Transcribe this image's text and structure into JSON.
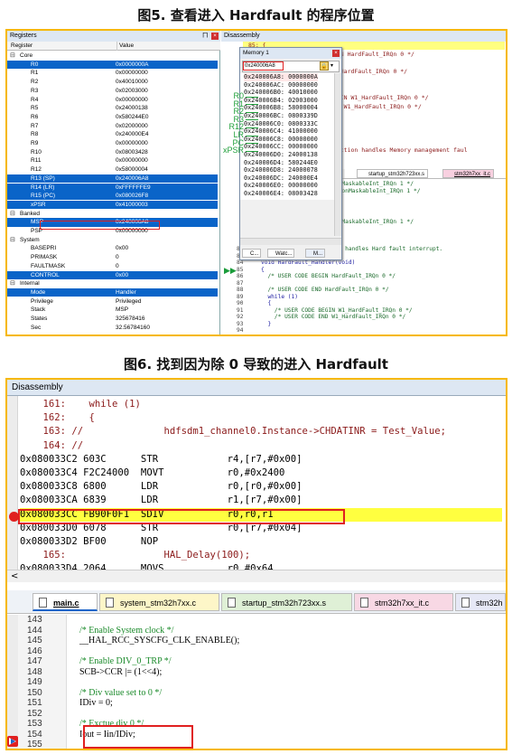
{
  "fig5": {
    "caption": "图5. 查看进入 Hardfault 的程序位置",
    "registers": {
      "title": "Registers",
      "pin_icon": "pin-icon",
      "col_register": "Register",
      "col_value": "Value",
      "rows": [
        {
          "name": "Core",
          "value": "",
          "kind": "group",
          "sel": false
        },
        {
          "name": "R0",
          "value": "0x0000000A",
          "kind": "reg",
          "sel": true
        },
        {
          "name": "R1",
          "value": "0x00000000",
          "kind": "reg",
          "sel": false
        },
        {
          "name": "R2",
          "value": "0x40010000",
          "kind": "reg",
          "sel": false
        },
        {
          "name": "R3",
          "value": "0x02003000",
          "kind": "reg",
          "sel": false
        },
        {
          "name": "R4",
          "value": "0x00000000",
          "kind": "reg",
          "sel": false
        },
        {
          "name": "R5",
          "value": "0x24000138",
          "kind": "reg",
          "sel": false
        },
        {
          "name": "R6",
          "value": "0x580244E0",
          "kind": "reg",
          "sel": false
        },
        {
          "name": "R7",
          "value": "0x02000000",
          "kind": "reg",
          "sel": false
        },
        {
          "name": "R8",
          "value": "0x240000E4",
          "kind": "reg",
          "sel": false
        },
        {
          "name": "R9",
          "value": "0x00000000",
          "kind": "reg",
          "sel": false
        },
        {
          "name": "R10",
          "value": "0x08003428",
          "kind": "reg",
          "sel": false
        },
        {
          "name": "R11",
          "value": "0x00000000",
          "kind": "reg",
          "sel": false
        },
        {
          "name": "R12",
          "value": "0x58000004",
          "kind": "reg",
          "sel": false
        },
        {
          "name": "R13 (SP)",
          "value": "0x240006A8",
          "kind": "reg",
          "sel": true
        },
        {
          "name": "R14 (LR)",
          "value": "0xFFFFFFE9",
          "kind": "reg",
          "sel": true
        },
        {
          "name": "R15 (PC)",
          "value": "0x080026F8",
          "kind": "reg",
          "sel": true
        },
        {
          "name": "xPSR",
          "value": "0x41000003",
          "kind": "reg",
          "sel": true
        },
        {
          "name": "Banked",
          "value": "",
          "kind": "group",
          "sel": false
        },
        {
          "name": "MSP",
          "value": "0x240006A8",
          "kind": "reg",
          "sel": true
        },
        {
          "name": "PSP",
          "value": "0x00000000",
          "kind": "reg",
          "sel": false
        },
        {
          "name": "System",
          "value": "",
          "kind": "group",
          "sel": false
        },
        {
          "name": "BASEPRI",
          "value": "0x00",
          "kind": "reg",
          "sel": false
        },
        {
          "name": "PRIMASK",
          "value": "0",
          "kind": "reg",
          "sel": false
        },
        {
          "name": "FAULTMASK",
          "value": "0",
          "kind": "reg",
          "sel": false
        },
        {
          "name": "CONTROL",
          "value": "0x00",
          "kind": "reg",
          "sel": true
        },
        {
          "name": "Internal",
          "value": "",
          "kind": "group",
          "sel": false
        },
        {
          "name": "Mode",
          "value": "Handler",
          "kind": "reg",
          "sel": true
        },
        {
          "name": "Privilege",
          "value": "Privileged",
          "kind": "reg",
          "sel": false
        },
        {
          "name": "Stack",
          "value": "MSP",
          "kind": "reg",
          "sel": false
        },
        {
          "name": "States",
          "value": "325678416",
          "kind": "reg",
          "sel": false
        },
        {
          "name": "Sec",
          "value": "32.56784160",
          "kind": "reg",
          "sel": false
        }
      ]
    },
    "disassembly": {
      "title": "Disassembly",
      "top_line": "85: {",
      "lines_right": [
        "EGIN HardFault_IRQn 0 */",
        "",
        "ND HardFault_IRQn 0 */",
        "",
        "",
        "BEGIN W1_HardFault_IRQn 0 */",
        "END W1_HardFault_IRQn 0 */",
        "",
        "",
        "",
        "",
        "function handles Memory management faul"
      ],
      "tabs": [
        "xx.c",
        "startup_stm32h723xx.s",
        "stm32h7xx_it.c"
      ],
      "nmi_lines": [
        "NonMaskableInt_IRQn 1 */",
        "N NonMaskableInt_IRQn 1 */",
        "",
        "",
        "",
        "NonMaskableInt_IRQn 1 */"
      ],
      "code": [
        {
          "num": "82",
          "text": "  * @brief This function handles Hard fault interrupt."
        },
        {
          "num": "83",
          "text": "  */"
        },
        {
          "num": "84",
          "text": "void HardFault_Handler(void)"
        },
        {
          "num": "85",
          "text": "{"
        },
        {
          "num": "86",
          "text": "  /* USER CODE BEGIN HardFault_IRQn 0 */"
        },
        {
          "num": "87",
          "text": ""
        },
        {
          "num": "88",
          "text": "  /* USER CODE END HardFault_IRQn 0 */"
        },
        {
          "num": "89",
          "text": "  while (1)"
        },
        {
          "num": "90",
          "text": "  {"
        },
        {
          "num": "91",
          "text": "    /* USER CODE BEGIN W1_HardFault_IRQn 0 */"
        },
        {
          "num": "92",
          "text": "    /* USER CODE END W1_HardFault_IRQn 0 */"
        },
        {
          "num": "93",
          "text": "  }"
        },
        {
          "num": "94",
          "text": ""
        }
      ]
    },
    "memory": {
      "title": "Memory 1",
      "address_input": "0x240006A8",
      "rows": [
        "0x240006A8: 0000000A",
        "0x240006AC: 00000000",
        "0x240006B0: 40010000",
        "0x240006B4: 02003000",
        "0x240006B8: 58000004",
        "0x240006BC: 0800339D",
        "0x240006C0: 0800333C",
        "0x240006C4: 41000000",
        "0x240006C8: 00000000",
        "0x240006CC: 00000000",
        "0x240006D0: 24000138",
        "0x240006D4: 580244E0",
        "0x240006D8: 24000078",
        "0x240006DC: 240000E4",
        "0x240006E0: 00000000",
        "0x240006E4: 08003428"
      ],
      "reg_labels": [
        "R0",
        "R1",
        "R2",
        "R3",
        "R12",
        "LR",
        "PC",
        "xPSR"
      ],
      "bottom_tabs": [
        "C...",
        "Watc...",
        "M..."
      ]
    }
  },
  "fig6": {
    "caption": "图6. 找到因为除 0 导致的进入 Hardfault",
    "disassembly": {
      "title": "Disassembly",
      "lines": [
        {
          "text": "    161:    while (1)",
          "color": "#8b1a1a"
        },
        {
          "text": "    162:    {",
          "color": "#8b1a1a"
        },
        {
          "text": "    163: //              hdfsdm1_channel0.Instance->CHDATINR = Test_Value;",
          "color": "#8b1a1a"
        },
        {
          "text": "    164: //",
          "color": "#8b1a1a"
        },
        {
          "text": "0x080033C2 603C      STR            r4,[r7,#0x00]",
          "color": "#000"
        },
        {
          "text": "0x080033C4 F2C24000  MOVT           r0,#0x2400",
          "color": "#000"
        },
        {
          "text": "0x080033C8 6800      LDR            r0,[r0,#0x00]",
          "color": "#000"
        },
        {
          "text": "0x080033CA 6839      LDR            r1,[r7,#0x00]",
          "color": "#000"
        },
        {
          "text": "0x080033CC FB90F0F1  SDIV           r0,r0,r1",
          "color": "#000"
        },
        {
          "text": "0x080033D0 6078      STR            r0,[r7,#0x04]",
          "color": "#000"
        },
        {
          "text": "0x080033D2 BF00      NOP",
          "color": "#000"
        },
        {
          "text": "    165:                 HAL_Delay(100);",
          "color": "#8b1a1a"
        },
        {
          "text": "0x080033D4 2064      MOVS           r0,#0x64",
          "color": "#000"
        }
      ],
      "scroll_left_icon": "chevron-left-icon"
    },
    "editor": {
      "tabs": [
        "main.c",
        "system_stm32h7xx.c",
        "startup_stm32h723xx.s",
        "stm32h7xx_it.c",
        "stm32h"
      ],
      "lines": [
        {
          "num": "143",
          "text": ""
        },
        {
          "num": "144",
          "text": "    /* Enable System clock */",
          "kind": "comment"
        },
        {
          "num": "145",
          "text": "    __HAL_RCC_SYSCFG_CLK_ENABLE();",
          "kind": "code"
        },
        {
          "num": "146",
          "text": ""
        },
        {
          "num": "147",
          "text": "    /* Enable DIV_0_TRP */",
          "kind": "comment"
        },
        {
          "num": "148",
          "text": "    SCB->CCR |= (1<<4);",
          "kind": "code"
        },
        {
          "num": "149",
          "text": ""
        },
        {
          "num": "150",
          "text": "    /* Div value set to 0 */",
          "kind": "comment"
        },
        {
          "num": "151",
          "text": "    IDiv = 0;",
          "kind": "code"
        },
        {
          "num": "152",
          "text": ""
        },
        {
          "num": "153",
          "text": "    /* Exctue div 0 */",
          "kind": "comment"
        },
        {
          "num": "154",
          "text": "    Iout = Iin/IDiv;",
          "kind": "code"
        },
        {
          "num": "155",
          "text": ""
        }
      ]
    }
  }
}
